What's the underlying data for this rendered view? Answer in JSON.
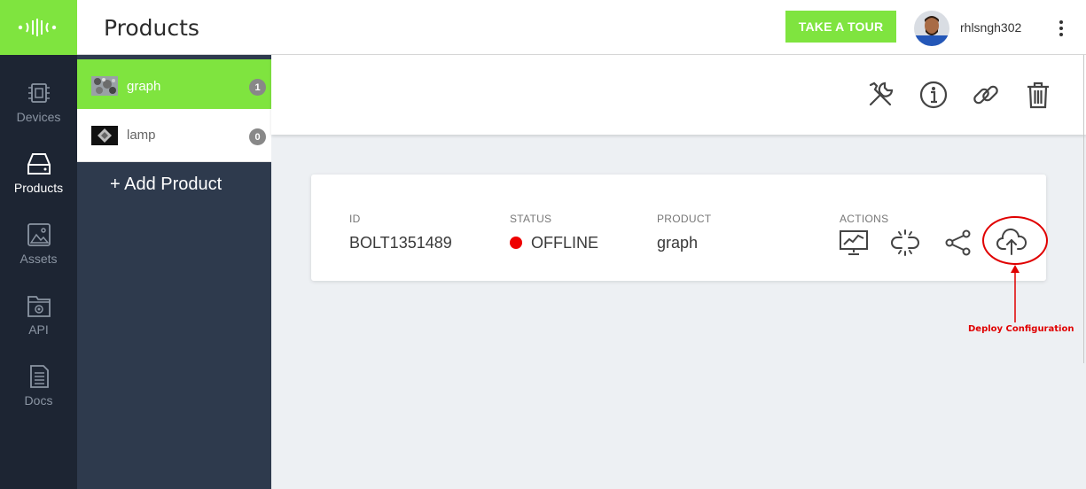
{
  "header": {
    "title": "Products",
    "tour_button": "TAKE A TOUR",
    "username": "rhlsngh302"
  },
  "nav": {
    "items": [
      {
        "label": "Devices",
        "icon": "chip-icon"
      },
      {
        "label": "Products",
        "icon": "drive-icon",
        "active": true
      },
      {
        "label": "Assets",
        "icon": "image-icon"
      },
      {
        "label": "API",
        "icon": "gear-folder-icon"
      },
      {
        "label": "Docs",
        "icon": "document-icon"
      }
    ]
  },
  "products": {
    "items": [
      {
        "name": "graph",
        "count": "1",
        "selected": true
      },
      {
        "name": "lamp",
        "count": "0",
        "selected": false
      }
    ],
    "add_label": "+ Add Product"
  },
  "toolbar": {
    "icons": [
      "tools-icon",
      "info-icon",
      "link-icon",
      "trash-icon"
    ]
  },
  "device": {
    "headers": {
      "id": "ID",
      "status": "STATUS",
      "product": "PRODUCT",
      "actions": "ACTIONS"
    },
    "id": "BOLT1351489",
    "status": "OFFLINE",
    "status_color": "#ee0000",
    "product": "graph",
    "actions": [
      "chart-icon",
      "unlink-icon",
      "share-icon",
      "cloud-upload-icon"
    ]
  },
  "annotation": {
    "text": "Deploy Configuration",
    "color": "#e00000"
  },
  "colors": {
    "accent": "#7fe43f",
    "sidebar": "#1d2533",
    "product_panel": "#2e3a4d"
  }
}
